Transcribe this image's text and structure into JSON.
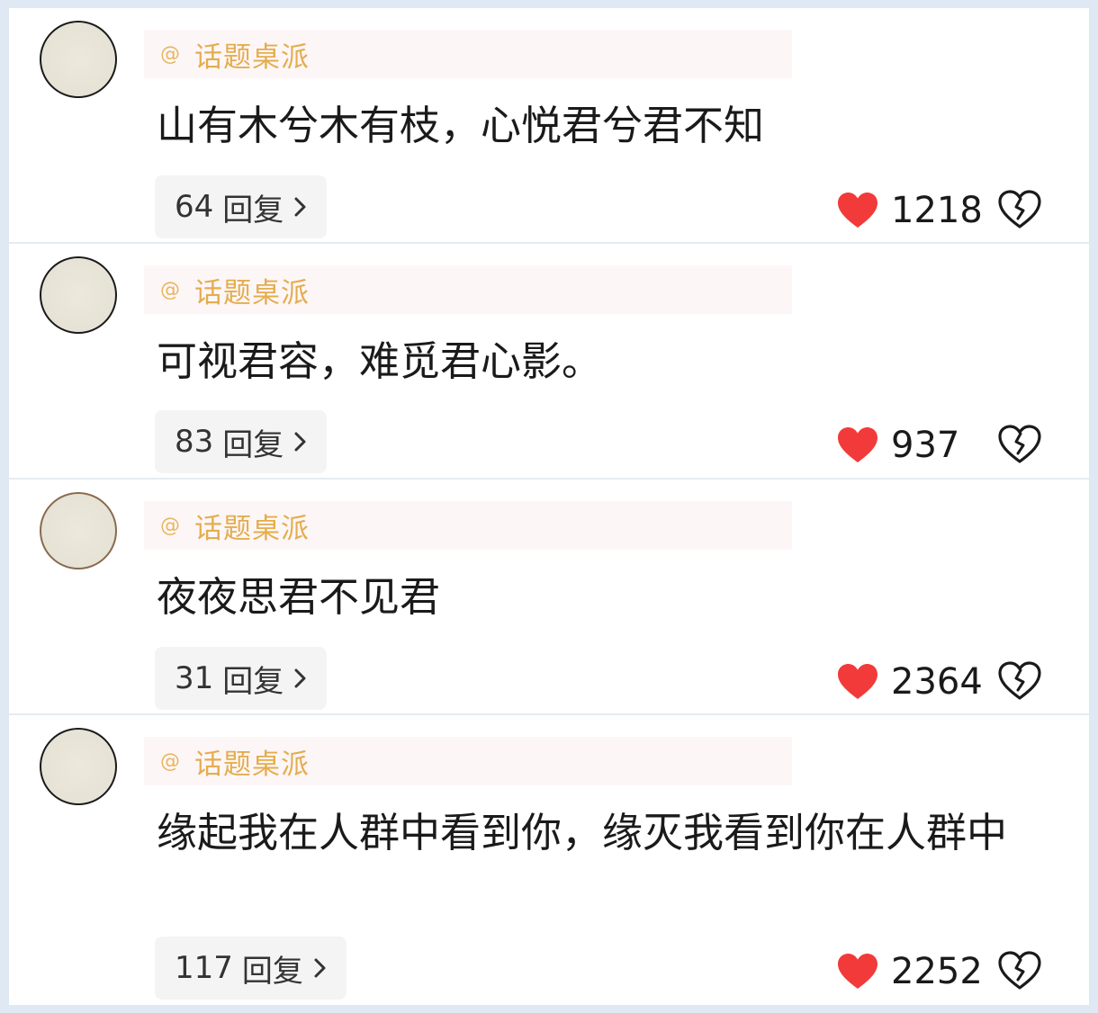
{
  "colors": {
    "background": "#dfe9f3",
    "card": "#ffffff",
    "username": "#e4ad4e",
    "heart": "#f23a3a",
    "reply_bg": "#f4f4f4"
  },
  "comments": [
    {
      "at": "@",
      "username": "话题桌派",
      "text": "山有木兮木有枝，心悦君兮君不知",
      "reply_count": "64",
      "reply_label": "回复",
      "likes": "1218"
    },
    {
      "at": "@",
      "username": "话题桌派",
      "text": "可视君容，难觅君心影。",
      "reply_count": "83",
      "reply_label": "回复",
      "likes": "937"
    },
    {
      "at": "@",
      "username": "话题桌派",
      "text": "夜夜思君不见君",
      "reply_count": "31",
      "reply_label": "回复",
      "likes": "2364"
    },
    {
      "at": "@",
      "username": "话题桌派",
      "text": "缘起我在人群中看到你，缘灭我看到你在人群中",
      "reply_count": "117",
      "reply_label": "回复",
      "likes": "2252"
    }
  ],
  "icons": {
    "avatar": "user-avatar",
    "chevron": "chevron-right-icon",
    "like": "heart-icon",
    "dislike": "broken-heart-icon"
  }
}
